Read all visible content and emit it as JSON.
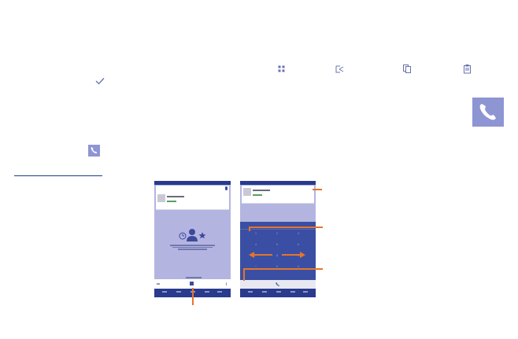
{
  "icons": {
    "check": "check-icon",
    "phone_small": "phone-icon",
    "phone_large": "phone-icon",
    "toolbar": [
      "apps-grid-icon",
      "share-icon",
      "copy-icon",
      "clipboard-icon"
    ]
  },
  "colors": {
    "icon_tile": "#8e95d3",
    "accent_orange": "#e8742a",
    "screen_bg": "#b3b5e0",
    "bar_dark": "#2a3a8c",
    "rule": "#1a3c8c"
  },
  "dialpad_keys": [
    "1",
    "2",
    "3",
    "4",
    "5",
    "6",
    "7",
    "8",
    "9",
    "*",
    "0",
    "#"
  ]
}
